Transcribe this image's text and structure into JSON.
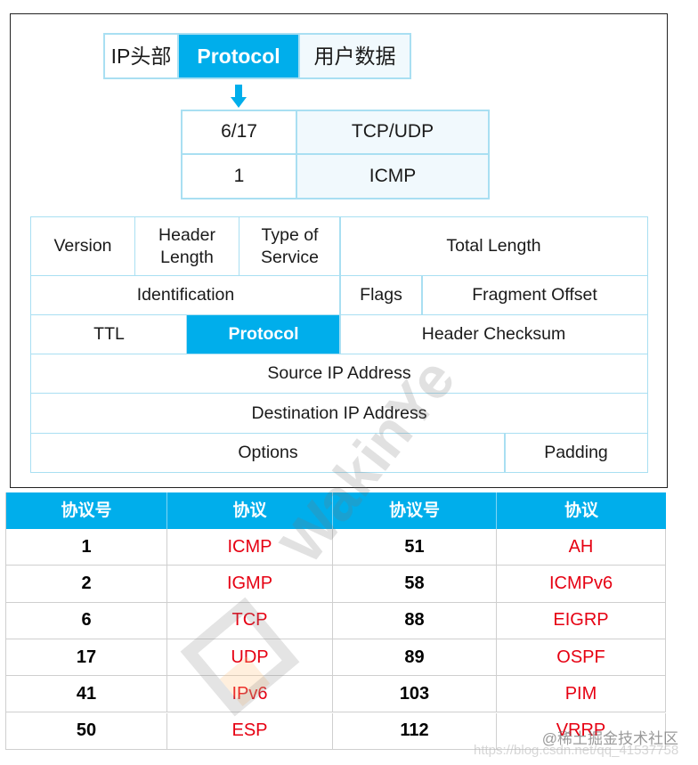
{
  "diagram": {
    "colors": {
      "highlight": "#00aeeb",
      "border": "#a9dff2",
      "protocol_text": "#e60012"
    },
    "top_bar": {
      "cells": [
        "IP头部",
        "Protocol",
        "用户数据"
      ],
      "highlighted_index": 1
    },
    "arrow_icon": "arrow-down-icon",
    "mapping_table": {
      "rows": [
        {
          "value": "6/17",
          "protocol": "TCP/UDP"
        },
        {
          "value": "1",
          "protocol": "ICMP"
        }
      ]
    },
    "ip_header": {
      "row1": [
        "Version",
        "Header Length",
        "Type of Service",
        "Total Length"
      ],
      "row2": [
        "Identification",
        "Flags",
        "Fragment Offset"
      ],
      "row3": [
        "TTL",
        "Protocol",
        "Header Checksum"
      ],
      "row4": [
        "Source IP Address"
      ],
      "row5": [
        "Destination IP Address"
      ],
      "row6": [
        "Options",
        "Padding"
      ]
    }
  },
  "protocol_table": {
    "headers": [
      "协议号",
      "协议",
      "协议号",
      "协议"
    ],
    "rows": [
      [
        "1",
        "ICMP",
        "51",
        "AH"
      ],
      [
        "2",
        "IGMP",
        "58",
        "ICMPv6"
      ],
      [
        "6",
        "TCP",
        "88",
        "EIGRP"
      ],
      [
        "17",
        "UDP",
        "89",
        "OSPF"
      ],
      [
        "41",
        "IPv6",
        "103",
        "PIM"
      ],
      [
        "50",
        "ESP",
        "112",
        "VRRP"
      ]
    ]
  },
  "watermarks": {
    "diagonal": "WakinYe",
    "credit": "@稀土掘金技术社区",
    "url": "https://blog.csdn.net/qq_41537758"
  }
}
